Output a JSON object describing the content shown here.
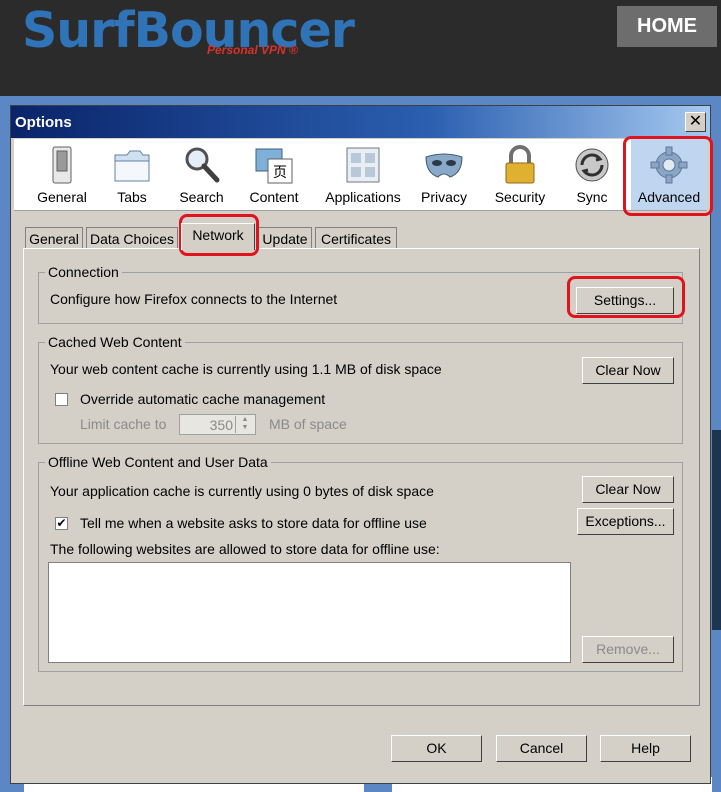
{
  "site": {
    "logo_text": "SurfBouncer",
    "logo_sub": "Personal VPN ®",
    "home_label": "HOME"
  },
  "dialog": {
    "title": "Options",
    "close_glyph": "✕"
  },
  "panes": [
    {
      "label": "General",
      "icon": "switch-icon"
    },
    {
      "label": "Tabs",
      "icon": "tabs-icon"
    },
    {
      "label": "Search",
      "icon": "magnifier-icon"
    },
    {
      "label": "Content",
      "icon": "content-icon"
    },
    {
      "label": "Applications",
      "icon": "applications-icon"
    },
    {
      "label": "Privacy",
      "icon": "mask-icon"
    },
    {
      "label": "Security",
      "icon": "padlock-icon"
    },
    {
      "label": "Sync",
      "icon": "sync-icon"
    },
    {
      "label": "Advanced",
      "icon": "gear-icon",
      "selected": true
    }
  ],
  "tabs": [
    {
      "label": "General"
    },
    {
      "label": "Data Choices"
    },
    {
      "label": "Network",
      "active": true
    },
    {
      "label": "Update"
    },
    {
      "label": "Certificates"
    }
  ],
  "connection": {
    "legend": "Connection",
    "description": "Configure how Firefox connects to the Internet",
    "settings_button": "Settings..."
  },
  "cache": {
    "legend": "Cached Web Content",
    "usage": "Your web content cache is currently using 1.1 MB of disk space",
    "clear_button": "Clear Now",
    "override_label": "Override automatic cache management",
    "override_checked": false,
    "limit_label": "Limit cache to",
    "limit_value": "350",
    "limit_unit": "MB of space"
  },
  "offline": {
    "legend": "Offline Web Content and User Data",
    "usage": "Your application cache is currently using 0 bytes of disk space",
    "clear_button": "Clear Now",
    "tell_label": "Tell me when a website asks to store data for offline use",
    "tell_checked": true,
    "check_glyph": "✔",
    "exceptions_button": "Exceptions...",
    "allowed_label": "The following websites are allowed to store data for offline use:",
    "remove_button": "Remove..."
  },
  "footer": {
    "ok": "OK",
    "cancel": "Cancel",
    "help": "Help"
  },
  "colors": {
    "highlight": "#e0141e",
    "logo_blue": "#2f74b8",
    "dialog_bg": "#d4d0c8"
  }
}
